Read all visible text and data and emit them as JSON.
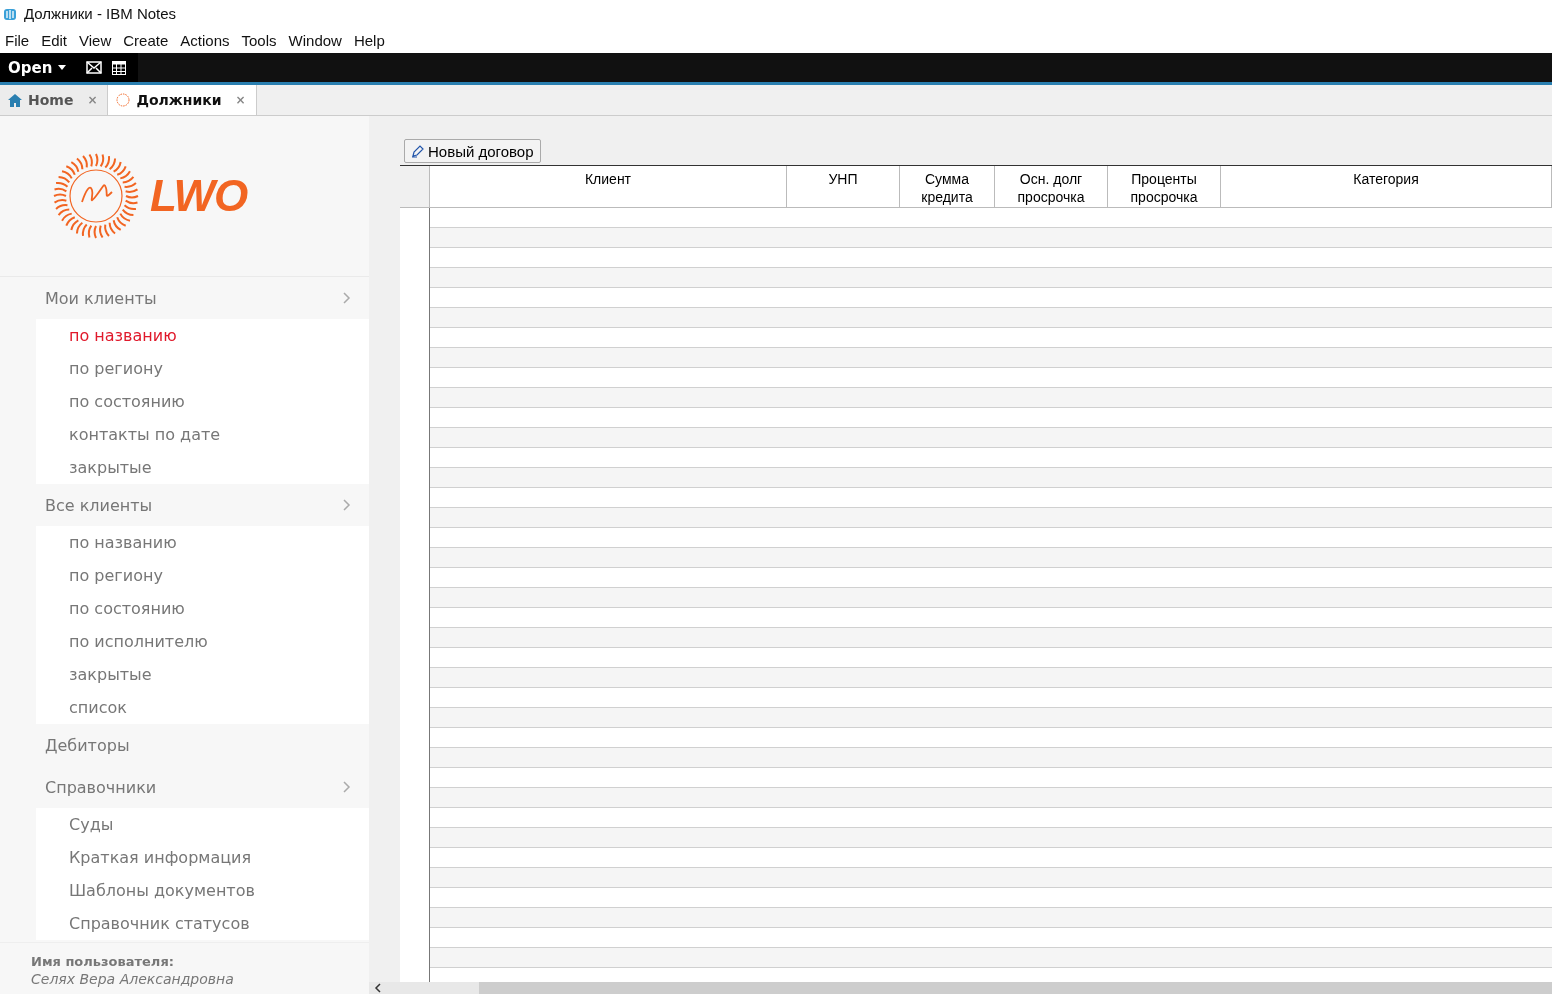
{
  "window": {
    "title": "Должники - IBM Notes"
  },
  "menu": [
    "File",
    "Edit",
    "View",
    "Create",
    "Actions",
    "Tools",
    "Window",
    "Help"
  ],
  "toolbar": {
    "open_label": "Open"
  },
  "tabs": [
    {
      "label": "Home",
      "kind": "home",
      "selected": false,
      "close": "×"
    },
    {
      "label": "Должники",
      "kind": "app",
      "selected": true,
      "close": "×"
    }
  ],
  "sidebar": {
    "logo_text": "LWO",
    "groups": [
      {
        "label": "Мои клиенты",
        "items": [
          {
            "label": "по названию",
            "selected": true
          },
          {
            "label": "по региону",
            "selected": false
          },
          {
            "label": "по состоянию",
            "selected": false
          },
          {
            "label": "контакты по дате",
            "selected": false
          },
          {
            "label": "закрытые",
            "selected": false
          }
        ]
      },
      {
        "label": "Все клиенты",
        "items": [
          {
            "label": "по названию",
            "selected": false
          },
          {
            "label": "по региону",
            "selected": false
          },
          {
            "label": "по состоянию",
            "selected": false
          },
          {
            "label": "по исполнителю",
            "selected": false
          },
          {
            "label": "закрытые",
            "selected": false
          },
          {
            "label": "список",
            "selected": false
          }
        ]
      },
      {
        "label": "Дебиторы"
      },
      {
        "label": "Справочники",
        "items": [
          {
            "label": "Суды",
            "selected": false
          },
          {
            "label": "Краткая информация",
            "selected": false
          },
          {
            "label": "Шаблоны документов",
            "selected": false
          },
          {
            "label": "Справочник статусов",
            "selected": false
          }
        ]
      }
    ],
    "user_label": "Имя пользователя:",
    "user_name": "Селях Вера Александровна"
  },
  "view": {
    "action_button": "Новый договор",
    "columns": [
      {
        "label": "Клиент"
      },
      {
        "label": "УНП"
      },
      {
        "label": "Сумма кредита"
      },
      {
        "label": "Осн. долг просрочка"
      },
      {
        "label": "Проценты просрочка"
      },
      {
        "label": "Категория"
      }
    ]
  }
}
